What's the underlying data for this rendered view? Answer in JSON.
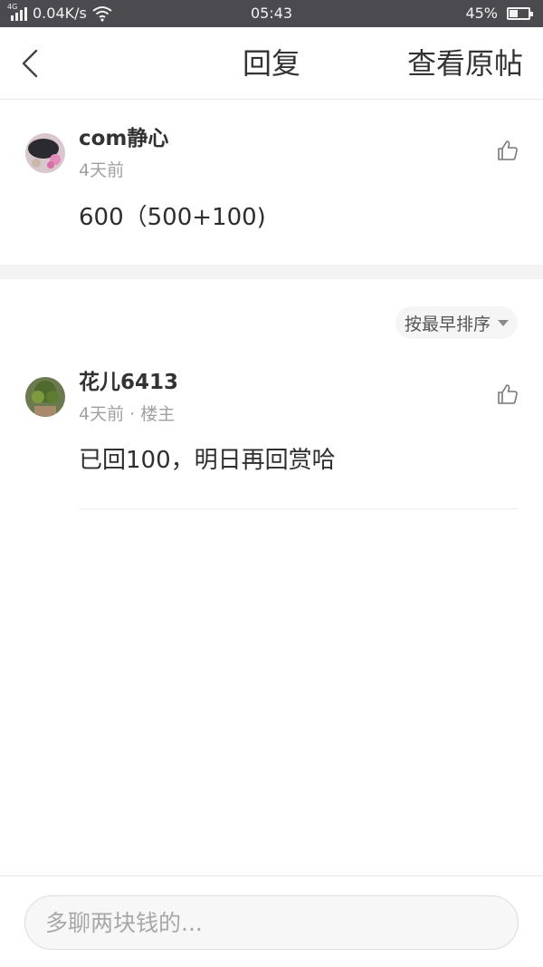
{
  "status_bar": {
    "network": "4G",
    "speed": "0.04K/s",
    "time": "05:43",
    "battery": "45%",
    "battery_level": 0.45
  },
  "header": {
    "title": "回复",
    "view_original": "查看原帖"
  },
  "original_comment": {
    "username": "com静心",
    "time": "4天前",
    "text": "600（500+100)"
  },
  "sort": {
    "label": "按最早排序"
  },
  "replies": [
    {
      "username": "花儿6413",
      "time": "4天前",
      "separator": "·",
      "badge": "楼主",
      "text": "已回100，明日再回赏哈"
    }
  ],
  "comment_box": {
    "placeholder": "多聊两块钱的..."
  },
  "colors": {
    "status_bar_bg": "#4a4a4f",
    "page_bg": "#ffffff",
    "divider_bg": "#f3f3f3",
    "meta_text": "#a0a0a0"
  }
}
